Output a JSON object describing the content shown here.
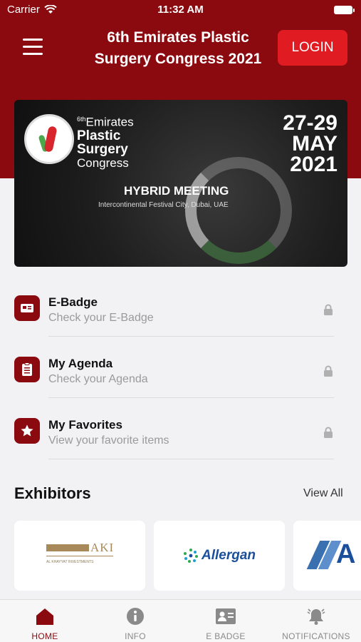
{
  "status_bar": {
    "carrier": "Carrier",
    "time": "11:32 AM"
  },
  "header": {
    "title": "6th Emirates Plastic Surgery Congress 2021",
    "login_label": "LOGIN"
  },
  "banner": {
    "logo_prefix": "6th",
    "logo_line1": "Emirates",
    "logo_line2": "Plastic",
    "logo_line3": "Surgery",
    "logo_line4": "Congress",
    "dates_line1": "27-29",
    "dates_line2": "MAY",
    "dates_line3": "2021",
    "headline": "HYBRID MEETING",
    "venue": "Intercontinental Festival City, Dubai, UAE"
  },
  "features": [
    {
      "title": "E-Badge",
      "subtitle": "Check your E-Badge",
      "icon": "badge-icon",
      "locked": true
    },
    {
      "title": "My Agenda",
      "subtitle": "Check your Agenda",
      "icon": "agenda-icon",
      "locked": true
    },
    {
      "title": "My Favorites",
      "subtitle": "View your favorite items",
      "icon": "star-icon",
      "locked": true
    }
  ],
  "exhibitors": {
    "title": "Exhibitors",
    "view_all": "View All",
    "items": [
      {
        "name": "AKI",
        "caption": "AL KHAYYAT INVESTMENTS"
      },
      {
        "name": "Allergan"
      },
      {
        "name": "A"
      }
    ]
  },
  "tabbar": {
    "tabs": [
      {
        "label": "HOME",
        "icon": "home-icon",
        "active": true
      },
      {
        "label": "INFO",
        "icon": "info-icon",
        "active": false
      },
      {
        "label": "E BADGE",
        "icon": "badge-card-icon",
        "active": false
      },
      {
        "label": "NOTIFICATIONS",
        "icon": "bell-icon",
        "active": false
      }
    ]
  },
  "colors": {
    "brand": "#8b0a0f",
    "login_button": "#e11b22",
    "background": "#f2f2f5"
  }
}
